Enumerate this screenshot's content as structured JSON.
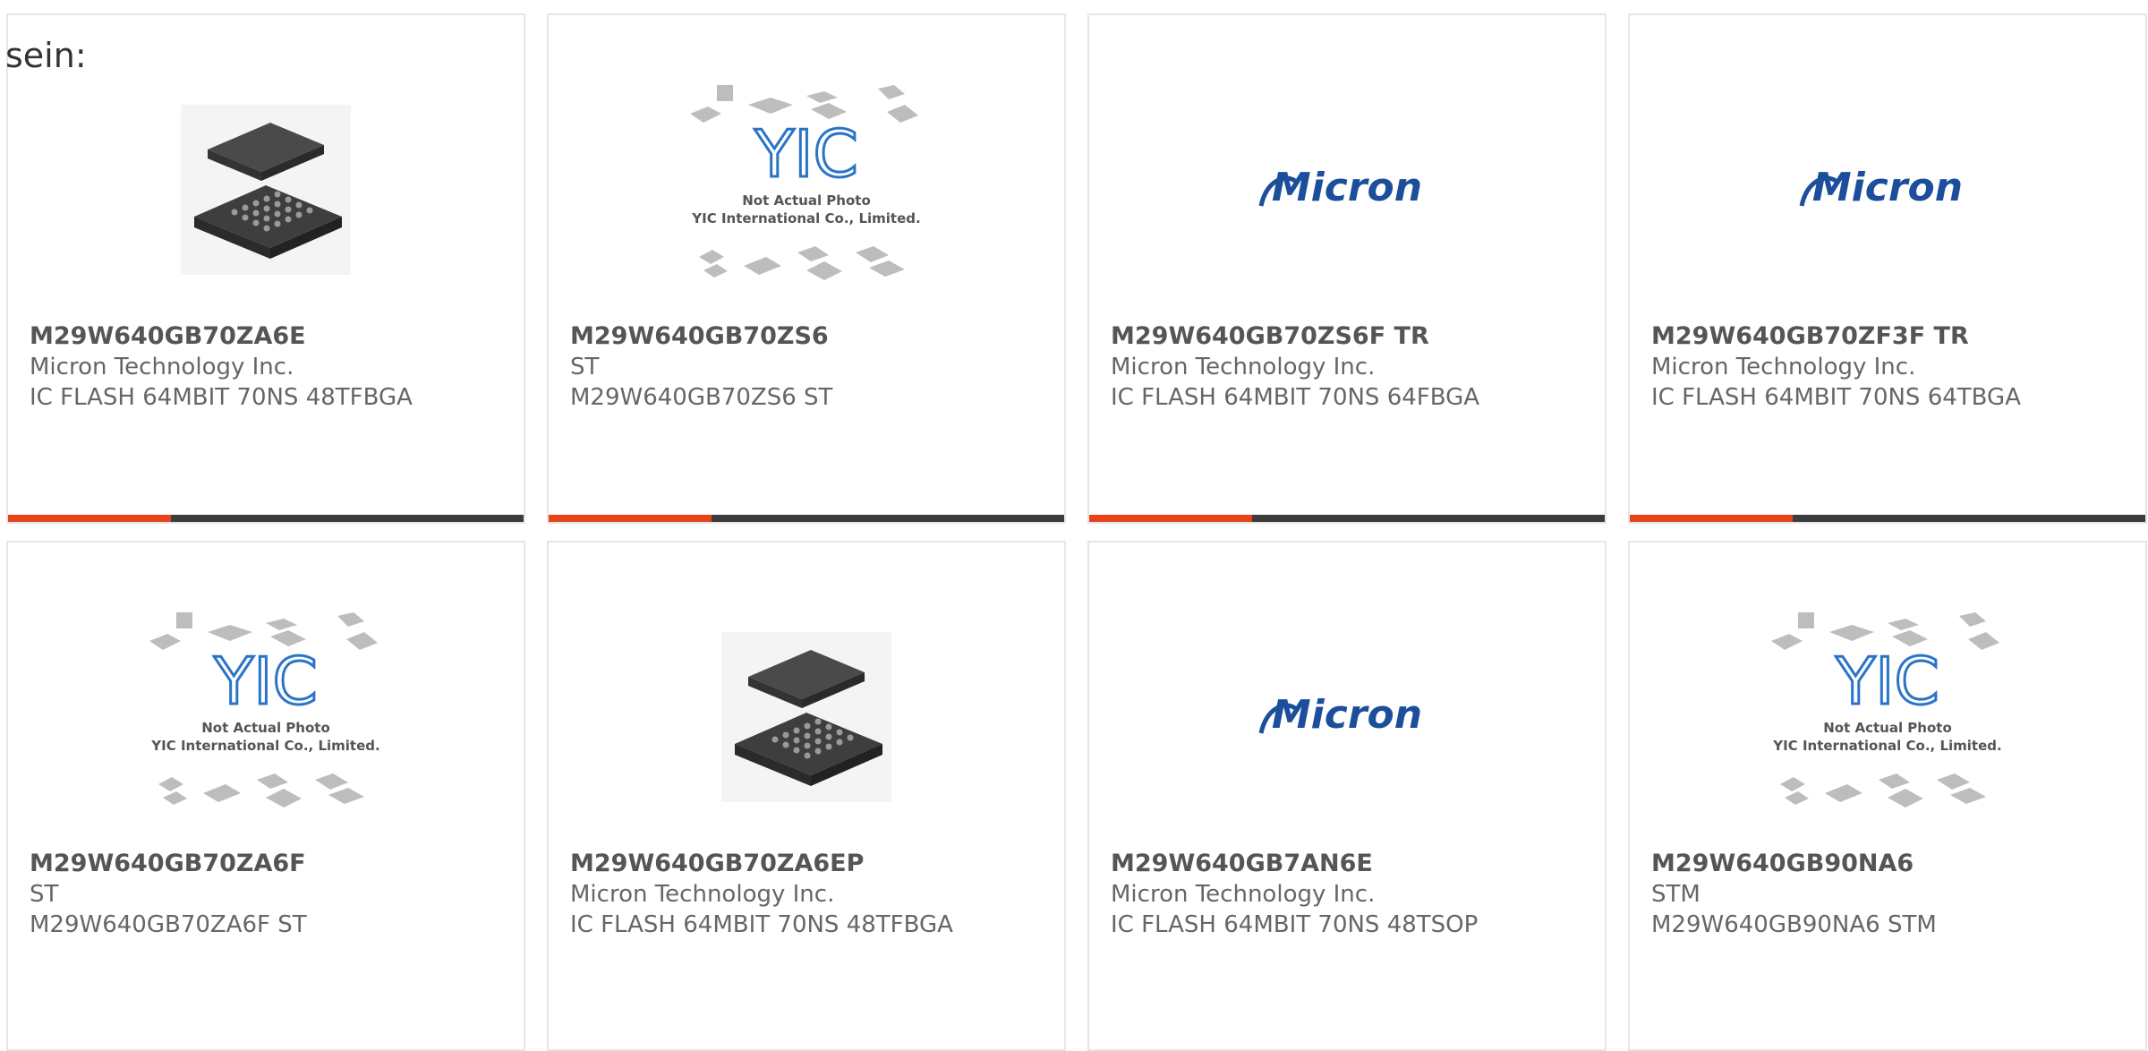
{
  "prefix_text": "sein:",
  "colors": {
    "accent": "#e8431a",
    "bar_dark": "#3c3c3c",
    "brand_micron": "#1b4e9b",
    "yic_blue": "#2a74c8"
  },
  "products": [
    {
      "part": "M29W640GB70ZA6E",
      "maker": "Micron Technology Inc.",
      "desc": "IC FLASH 64MBIT 70NS 48TFBGA",
      "image": "bga-chip-photo"
    },
    {
      "part": "M29W640GB70ZS6",
      "maker": "ST",
      "desc": "M29W640GB70ZS6 ST",
      "image": "yic-placeholder"
    },
    {
      "part": "M29W640GB70ZS6F TR",
      "maker": "Micron Technology Inc.",
      "desc": "IC FLASH 64MBIT 70NS 64FBGA",
      "image": "micron-logo"
    },
    {
      "part": "M29W640GB70ZF3F TR",
      "maker": "Micron Technology Inc.",
      "desc": "IC FLASH 64MBIT 70NS 64TBGA",
      "image": "micron-logo"
    },
    {
      "part": "M29W640GB70ZA6F",
      "maker": "ST",
      "desc": "M29W640GB70ZA6F ST",
      "image": "yic-placeholder"
    },
    {
      "part": "M29W640GB70ZA6EP",
      "maker": "Micron Technology Inc.",
      "desc": "IC FLASH 64MBIT 70NS 48TFBGA",
      "image": "bga-chip-photo"
    },
    {
      "part": "M29W640GB7AN6E",
      "maker": "Micron Technology Inc.",
      "desc": "IC FLASH 64MBIT 70NS 48TSOP",
      "image": "micron-logo"
    },
    {
      "part": "M29W640GB90NA6",
      "maker": "STM",
      "desc": "M29W640GB90NA6 STM",
      "image": "yic-placeholder"
    }
  ],
  "yic": {
    "logo": "YIC",
    "line1": "Not Actual Photo",
    "line2": "YIC International Co., Limited."
  },
  "micron": {
    "logo": "Micron"
  }
}
